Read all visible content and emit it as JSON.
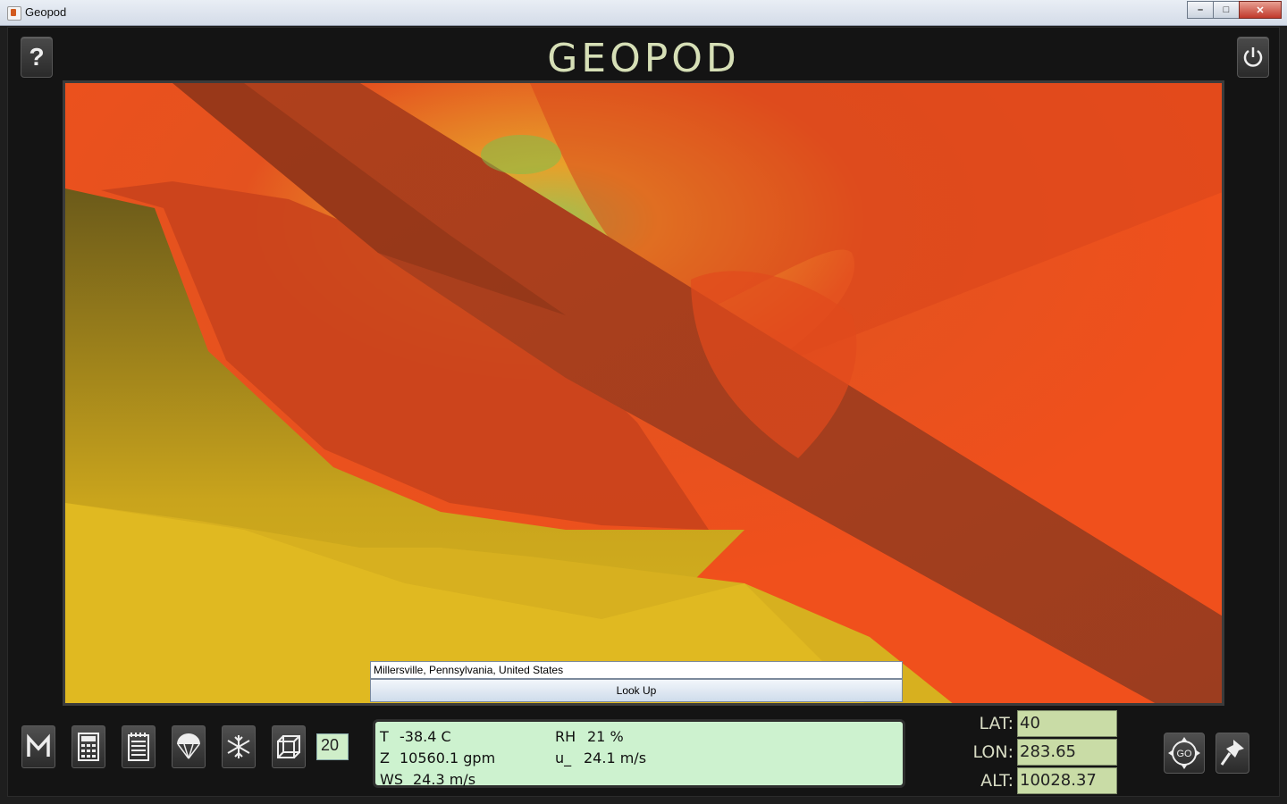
{
  "window": {
    "title": "Geopod"
  },
  "header": {
    "logo": "GEOPOD",
    "help_icon": "question-icon",
    "power_icon": "power-icon"
  },
  "location": {
    "value": "Millersville, Pennsylvania, United States",
    "lookup_label": "Look Up"
  },
  "toolbar": {
    "icons": [
      "m-icon",
      "calculator-icon",
      "notepad-icon",
      "parachute-icon",
      "snowflake-icon",
      "cube-icon"
    ],
    "step_value": "20"
  },
  "readout": {
    "t_label": "T",
    "t_value": "-38.4 C",
    "rh_label": "RH",
    "rh_value": "21 %",
    "z_label": "Z",
    "z_value": "10560.1 gpm",
    "u_label": "u_",
    "u_value": "24.1 m/s",
    "ws_label": "WS",
    "ws_value": "24.3 m/s"
  },
  "coords": {
    "lat_label": "LAT:",
    "lat_value": "40",
    "lon_label": "LON:",
    "lon_value": "283.65",
    "alt_label": "ALT:",
    "alt_value": "10028.37"
  },
  "actions": {
    "go_label": "GO",
    "pin_icon": "pushpin-icon"
  },
  "colors": {
    "logo": "#d6dfb6",
    "readout_bg": "#cdf2cf",
    "coord_bg": "#c9dca6"
  }
}
